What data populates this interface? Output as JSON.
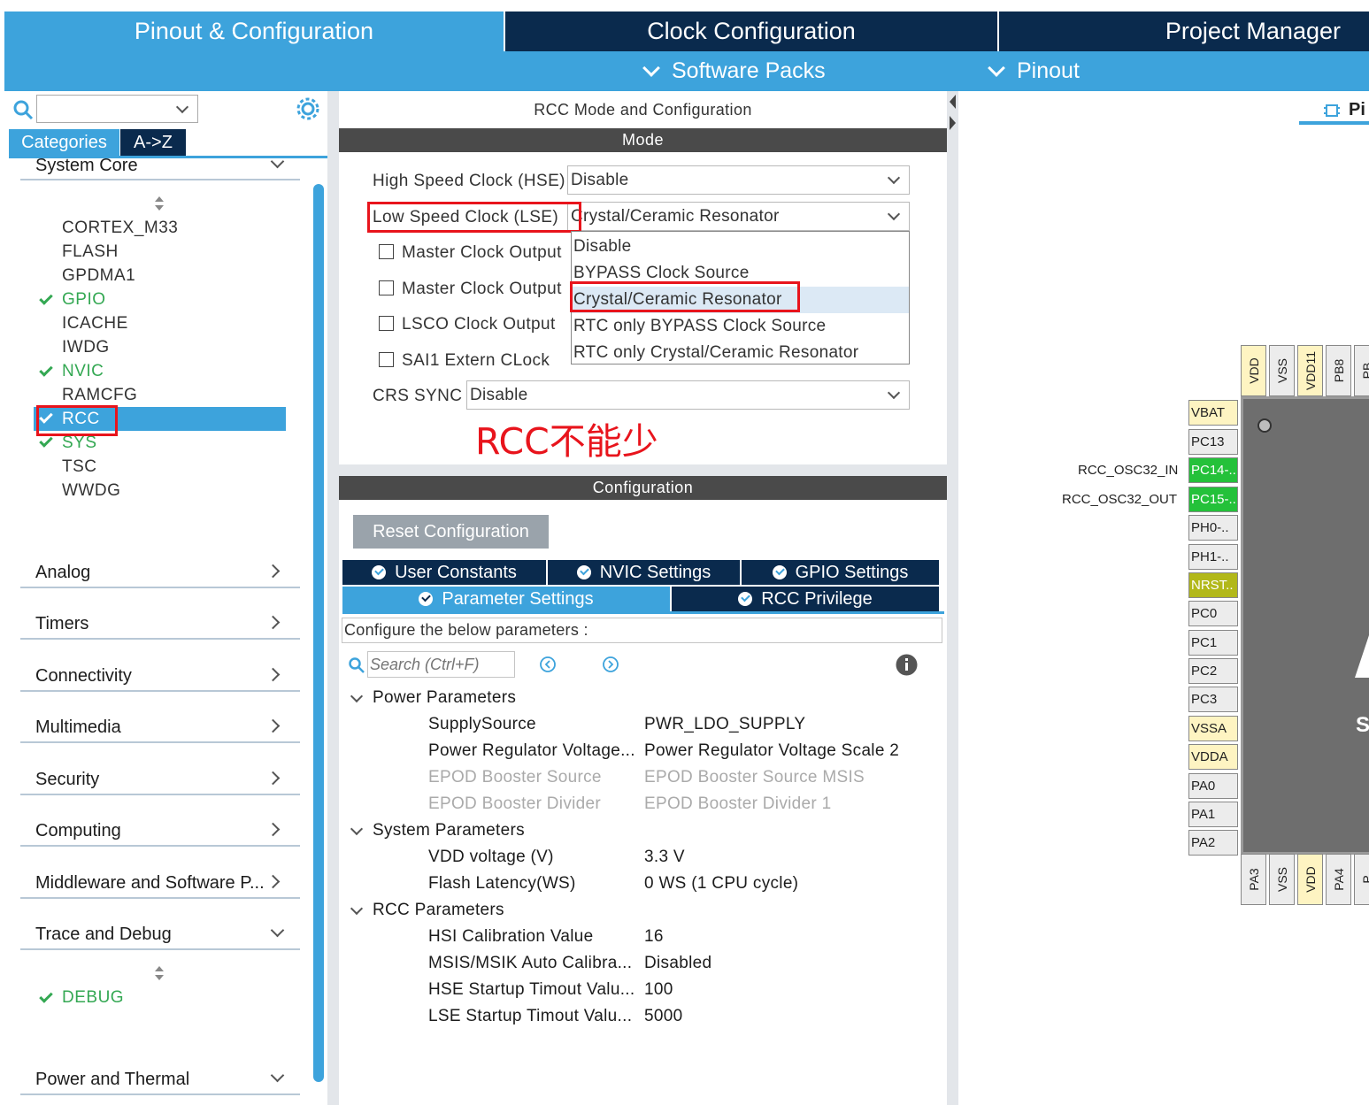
{
  "top_tabs": {
    "pinout_config": "Pinout & Configuration",
    "clock_config": "Clock Configuration",
    "project_manager": "Project Manager"
  },
  "sub_tabs": {
    "software_packs": "Software Packs",
    "pinout": "Pinout"
  },
  "left": {
    "search_value": "",
    "view_tabs": {
      "categories": "Categories",
      "a_to_z": "A->Z"
    },
    "system_core_label": "System Core",
    "peripherals": [
      {
        "name": "CORTEX_M33",
        "enabled": false
      },
      {
        "name": "FLASH",
        "enabled": false
      },
      {
        "name": "GPDMA1",
        "enabled": false
      },
      {
        "name": "GPIO",
        "enabled": true
      },
      {
        "name": "ICACHE",
        "enabled": false
      },
      {
        "name": "IWDG",
        "enabled": false
      },
      {
        "name": "NVIC",
        "enabled": true
      },
      {
        "name": "RAMCFG",
        "enabled": false
      },
      {
        "name": "RCC",
        "enabled": true,
        "selected": true
      },
      {
        "name": "SYS",
        "enabled": true
      },
      {
        "name": "TSC",
        "enabled": false
      },
      {
        "name": "WWDG",
        "enabled": false
      }
    ],
    "categories": [
      "Analog",
      "Timers",
      "Connectivity",
      "Multimedia",
      "Security",
      "Computing",
      "Middleware and Software P..."
    ],
    "trace_debug": "Trace and Debug",
    "debug_item": "DEBUG",
    "power_thermal": "Power and Thermal"
  },
  "mode": {
    "panel_title": "RCC Mode and Configuration",
    "header": "Mode",
    "hse_label": "High Speed Clock (HSE)",
    "hse_value": "Disable",
    "lse_label": "Low Speed Clock (LSE)",
    "lse_value": "Crystal/Ceramic Resonator",
    "mco1_label": "Master Clock Output",
    "mco2_label": "Master Clock Output",
    "lsco_label": "LSCO Clock Output",
    "sai1_label": "SAI1 Extern CLock",
    "crs_label": "CRS SYNC",
    "crs_value": "Disable",
    "dropdown_options": [
      "Disable",
      "BYPASS Clock Source",
      "Crystal/Ceramic Resonator",
      "RTC only BYPASS Clock Source",
      "RTC only Crystal/Ceramic Resonator"
    ],
    "annotation": "RCC不能少"
  },
  "config": {
    "header": "Configuration",
    "reset_button": "Reset Configuration",
    "tabs_row1": [
      "User Constants",
      "NVIC Settings",
      "GPIO Settings"
    ],
    "tabs_row2": [
      "Parameter Settings",
      "RCC Privilege"
    ],
    "description": "Configure the below parameters :",
    "search_placeholder": "Search (Ctrl+F)",
    "groups": {
      "power": "Power Parameters",
      "system": "System Parameters",
      "rcc": "RCC Parameters"
    },
    "params": [
      {
        "name": "SupplySource",
        "value": "PWR_LDO_SUPPLY"
      },
      {
        "name": "Power Regulator Voltage...",
        "value": "Power Regulator Voltage Scale 2"
      },
      {
        "name": "EPOD Booster Source",
        "value": "EPOD Booster Source MSIS"
      },
      {
        "name": "EPOD Booster Divider",
        "value": "EPOD Booster Divider 1"
      },
      {
        "name": "VDD voltage (V)",
        "value": "3.3 V"
      },
      {
        "name": "Flash Latency(WS)",
        "value": "0 WS (1 CPU cycle)"
      },
      {
        "name": "HSI Calibration Value",
        "value": "16"
      },
      {
        "name": "MSIS/MSIK Auto Calibra...",
        "value": "Disabled"
      },
      {
        "name": "HSE Startup Timout Valu...",
        "value": "100"
      },
      {
        "name": "LSE Startup Timout Valu...",
        "value": "5000"
      }
    ]
  },
  "pinout": {
    "view_label": "Pi",
    "chip_letters": [
      "S"
    ],
    "top_pins": [
      "VDD",
      "VSS",
      "VDD11",
      "PB8",
      "PB"
    ],
    "left_pins": [
      "VBAT",
      "PC13",
      "PC14-..",
      "PC15-..",
      "PH0-..",
      "PH1-..",
      "NRST..",
      "PC0",
      "PC1",
      "PC2",
      "PC3",
      "VSSA",
      "VDDA",
      "PA0",
      "PA1",
      "PA2"
    ],
    "bottom_pins": [
      "PA3",
      "VSS",
      "VDD",
      "PA4",
      "P"
    ],
    "signals": {
      "osc_in": "RCC_OSC32_IN",
      "osc_out": "RCC_OSC32_OUT"
    }
  },
  "colors": {
    "accent_blue": "#3da3dc",
    "navy": "#0a2a4d",
    "enabled_green": "#34a853",
    "highlight_red": "#e8141c"
  }
}
